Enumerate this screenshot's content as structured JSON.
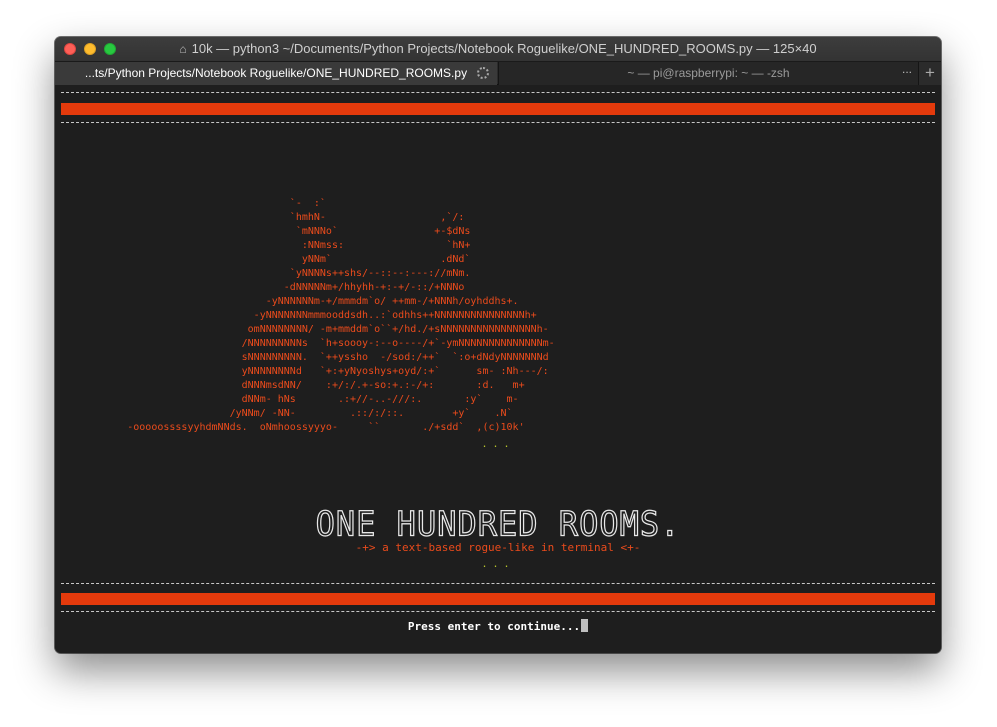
{
  "window": {
    "title": "10k — python3 ~/Documents/Python Projects/Notebook Roguelike/ONE_HUNDRED_ROOMS.py — 125×40",
    "title_icon": "home-icon"
  },
  "tabs": [
    {
      "label": "...ts/Python Projects/Notebook Roguelike/ONE_HUNDRED_ROOMS.py",
      "active": true
    },
    {
      "label": "~ — pi@raspberrypi: ~ — -zsh",
      "active": false
    }
  ],
  "tabbar": {
    "overflow_label": "...",
    "new_tab_label": "+"
  },
  "screen": {
    "art": "                                       `-  :`\n                                       `hmhN-                   ,`/:\n                                        `mNNNo`                +-$dNs\n                                         :NNmss:                 `hN+\n                                         yNNm`                  .dNd`\n                                       `yNNNNs++shs/--::--:---://mNm.\n                                      -dNNNNNm+/hhyhh-+:-+/-::/+NNNo\n                                   -yNNNNNNm-+/mmmdm`o/ ++mm-/+NNNh/oyhddhs+.\n                                 -yNNNNNNNmmmooddsdh..:`odhhs++NNNNNNNNNNNNNNNh+\n                                omNNNNNNNN/ -m+mmddm`o``+/hd./+sNNNNNNNNNNNNNNNNh-\n                               /NNNNNNNNNs  `h+soooy-:--o----/+`-ymNNNNNNNNNNNNNNm-\n                               sNNNNNNNNN.  `++yssho  -/sod:/++`  `:o+dNdyNNNNNNNd\n                               yNNNNNNNNd   `+:+yNyoshys+oyd/:+`      sm- :Nh---/:\n                               dNNNmsdNN/    :+/:/.+-so:+.:-/+:       :d.   m+\n                               dNNm- hNs       .:+//-..-///:.       :y`    m-\n                             /yNNm/ -NN-         .::/:/::.        +y`    .N`\n            -ooooossssyyhdmNNds.  oNmhoossyyyo-     ``       ./+sdd`  ,(c)10k'",
    "dots_top": "...",
    "game_title": "ONE HUNDRED ROOMS.",
    "subtitle": "-+> a text-based rogue-like in terminal <+-",
    "dots_bottom": "...",
    "prompt": "Press enter to continue..."
  },
  "colors": {
    "accent": "#e43a0c",
    "art": "#ea4b1c",
    "dots": "#b8c52b",
    "background": "#1e1e1e"
  }
}
